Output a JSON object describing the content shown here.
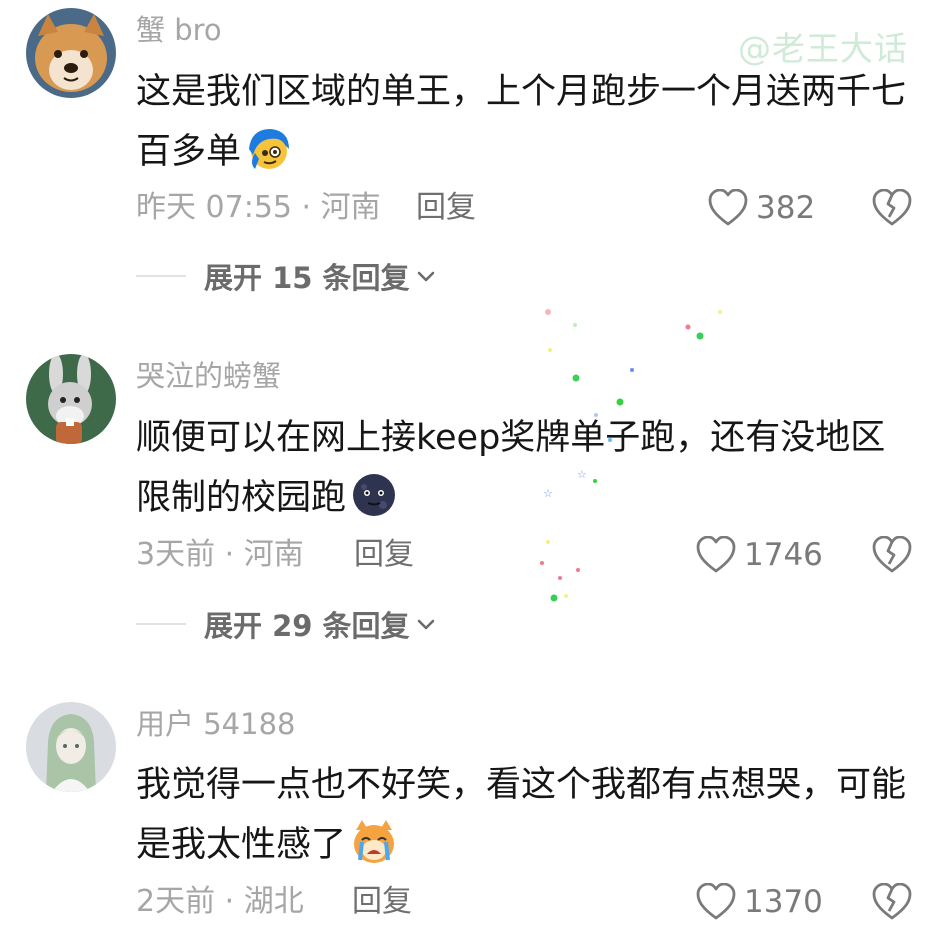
{
  "watermark": "@老王大话",
  "comments": [
    {
      "username": "蟹 bro",
      "text": "这是我们区域的单王，上个月跑步一个月送两千七百多单",
      "time_location": "昨天 07:55 · 河南",
      "reply_label": "回复",
      "likes": "382",
      "expand_label": "展开 15 条回复",
      "emoji": "blue-hair-face-emoji",
      "avatar": "shiba-dog-avatar"
    },
    {
      "username": "哭泣的螃蟹",
      "text": "顺便可以在网上接keep奖牌单子跑，还有没地区限制的校园跑",
      "time_location": "3天前 · 河南",
      "reply_label": "回复",
      "likes": "1746",
      "expand_label": "展开 29 条回复",
      "emoji": "dark-moon-face-emoji",
      "avatar": "bugs-bunny-avatar"
    },
    {
      "username": "用户 54188",
      "text": "我觉得一点也不好笑，看这个我都有点想哭，可能是我太性感了",
      "time_location": "2天前 · 湖北",
      "reply_label": "回复",
      "likes": "1370",
      "emoji": "crying-cat-emoji",
      "avatar": "anime-character-avatar"
    }
  ],
  "colors": {
    "username": "#a6a6a6",
    "text": "#161616",
    "meta": "#a6a6a6",
    "watermark": "#cfead7"
  }
}
